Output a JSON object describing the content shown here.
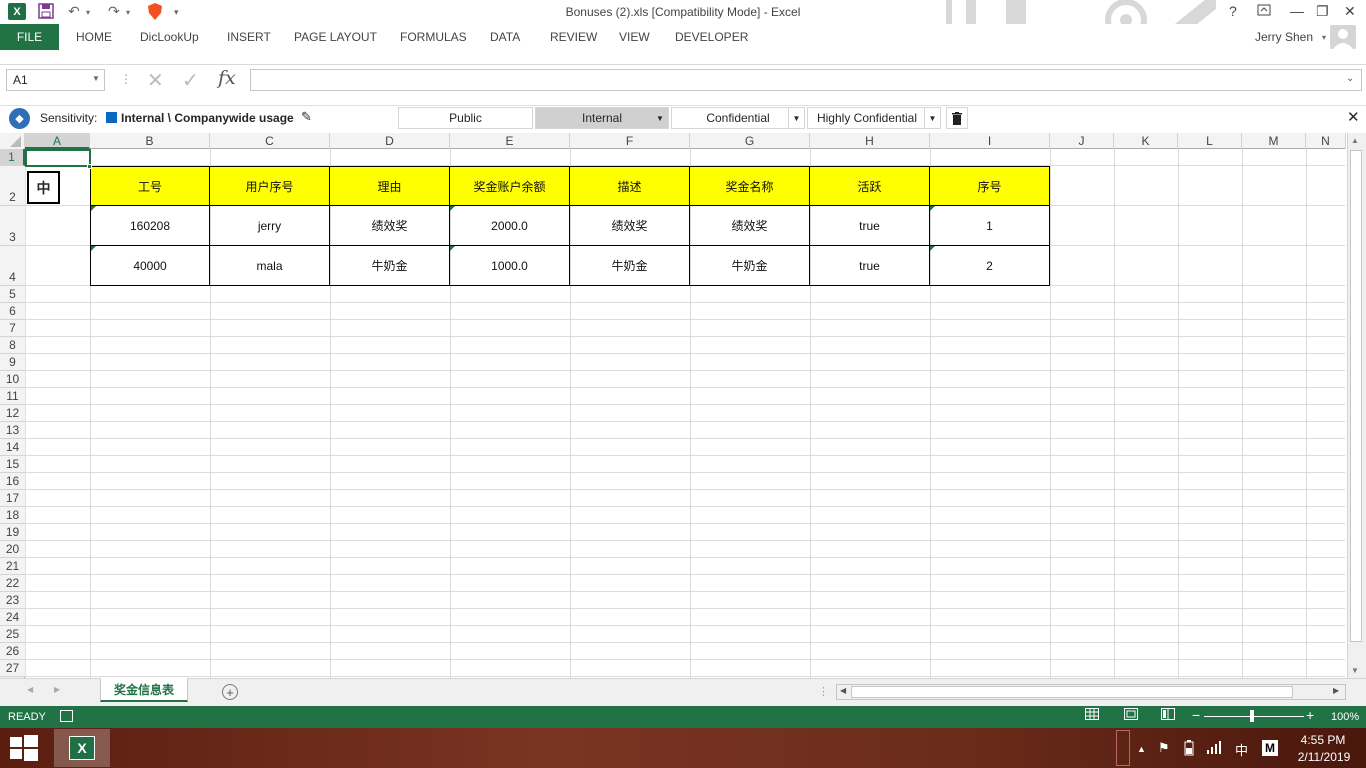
{
  "window": {
    "title": "Bonuses (2).xls  [Compatibility Mode] - Excel",
    "help": "?",
    "user": "Jerry Shen"
  },
  "ribbon": {
    "file": "FILE",
    "tabs": [
      "HOME",
      "DicLookUp",
      "INSERT",
      "PAGE LAYOUT",
      "FORMULAS",
      "DATA",
      "REVIEW",
      "VIEW",
      "DEVELOPER"
    ]
  },
  "formula_bar": {
    "name_box": "A1",
    "fx": "fx",
    "formula": ""
  },
  "sensitivity": {
    "label": "Sensitivity:",
    "current": "Internal \\ Companywide usage",
    "options": [
      "Public",
      "Internal",
      "Confidential",
      "Highly Confidential"
    ],
    "selected": "Internal"
  },
  "grid": {
    "columns": [
      "A",
      "B",
      "C",
      "D",
      "E",
      "F",
      "G",
      "H",
      "I",
      "J",
      "K",
      "L",
      "M",
      "N"
    ],
    "rows": [
      "1",
      "2",
      "3",
      "4",
      "5",
      "6",
      "7",
      "8",
      "9",
      "10",
      "11",
      "12",
      "13",
      "14",
      "15",
      "16",
      "17",
      "18",
      "19",
      "20",
      "21",
      "22",
      "23",
      "24",
      "25",
      "26",
      "27"
    ],
    "active_cell": "A1",
    "ime_indicator": "中"
  },
  "table": {
    "headers": [
      "工号",
      "用户序号",
      "理由",
      "奖金账户余额",
      "描述",
      "奖金名称",
      "活跃",
      "序号"
    ],
    "rows": [
      [
        "160208",
        "jerry",
        "绩效奖",
        "2000.0",
        "绩效奖",
        "绩效奖",
        "true",
        "1"
      ],
      [
        "40000",
        "mala",
        "牛奶金",
        "1000.0",
        "牛奶金",
        "牛奶金",
        "true",
        "2"
      ]
    ],
    "header_color": "#ffff00"
  },
  "sheets": {
    "tabs": [
      "奖金信息表"
    ],
    "active": "奖金信息表"
  },
  "status_bar": {
    "state": "READY",
    "zoom": "100%",
    "accent": "#217346"
  },
  "taskbar": {
    "time": "4:55 PM",
    "date": "2/11/2019",
    "ime": "中",
    "ime2": "M"
  }
}
